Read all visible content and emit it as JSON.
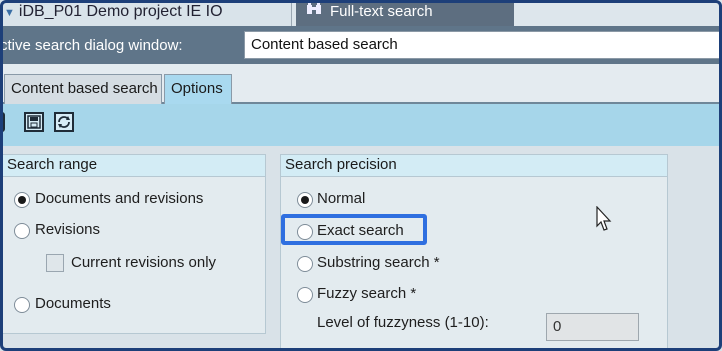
{
  "top_tabs": {
    "project": "iDB_P01  Demo project IE IO",
    "fulltext": "Full-text search"
  },
  "dialog": {
    "label": "ctive search dialog window:",
    "value": "Content based search"
  },
  "sub_tabs": [
    {
      "label": "Content based search"
    },
    {
      "label": "Options"
    }
  ],
  "toolbar": {
    "icons": [
      "save-icon",
      "refresh-icon"
    ]
  },
  "search_range": {
    "title": "Search range",
    "options": [
      {
        "label": "Documents and revisions",
        "selected": true
      },
      {
        "label": "Revisions",
        "selected": false
      },
      {
        "label": "Current revisions only",
        "type": "checkbox",
        "checked": false
      },
      {
        "label": "Documents",
        "selected": false
      }
    ]
  },
  "search_precision": {
    "title": "Search precision",
    "options": [
      {
        "label": "Normal",
        "selected": true
      },
      {
        "label": "Exact search",
        "selected": false
      },
      {
        "label": "Substring search *",
        "selected": false
      },
      {
        "label": "Fuzzy search *",
        "selected": false
      }
    ],
    "fuzziness_label": "Level of fuzzyness (1-10):",
    "fuzziness_value": "0"
  },
  "colors": {
    "highlight": "#2f6fe0",
    "toolbar": "#a6d6ea",
    "active_tab": "#a9d9ef",
    "frame": "#1d3f79"
  }
}
